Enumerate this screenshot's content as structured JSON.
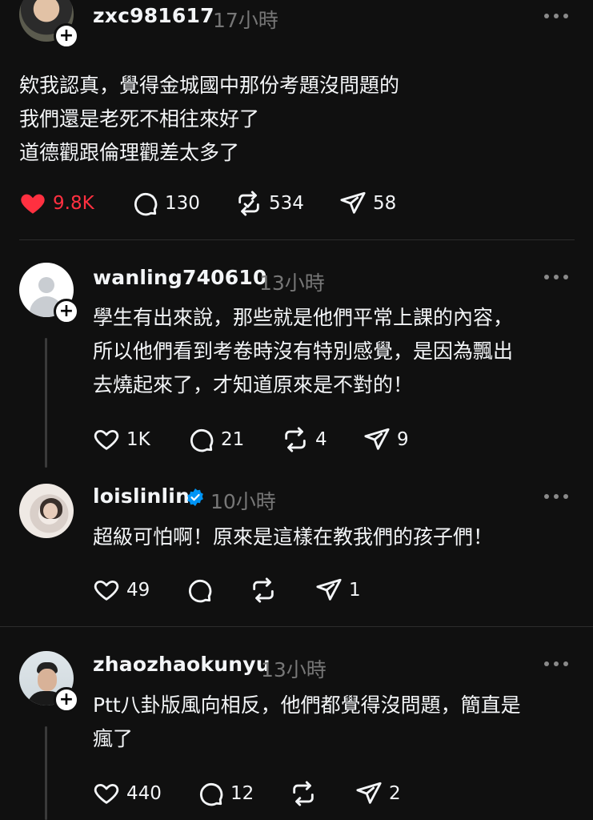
{
  "posts": [
    {
      "username": "zxc981617",
      "time": "17小時",
      "text": "欸我認真，覺得金城國中那份考題沒問題的\n我們還是老死不相往來好了\n道德觀跟倫理觀差太多了",
      "likes": "9.8K",
      "replies": "130",
      "reposts": "534",
      "shares": "58",
      "liked": true
    },
    {
      "username": "wanling740610",
      "time": "13小時",
      "text": "學生有出來說，那些就是他們平常上課的內容，\n所以他們看到考卷時沒有特別感覺，是因為飄出\n去燒起來了，才知道原來是不對的！",
      "likes": "1K",
      "replies": "21",
      "reposts": "4",
      "shares": "9"
    },
    {
      "username": "loislinlin",
      "time": "10小時",
      "text": "超級可怕啊！原來是這樣在教我們的孩子們！",
      "likes": "49",
      "shares": "1",
      "verified": true
    },
    {
      "username": "zhaozhaokunyu",
      "time": "13小時",
      "text": "Ptt八卦版風向相反，他們都覺得沒問題，簡直是\n瘋了",
      "likes": "440",
      "replies": "12",
      "shares": "2"
    }
  ],
  "colors": {
    "background": "#101010",
    "liked": "#ff3040",
    "verified": "#0095f6",
    "muted": "#777777"
  },
  "icons": [
    "heart-icon",
    "reply-icon",
    "repost-icon",
    "share-icon",
    "more-icon",
    "follow-plus-icon",
    "verified-badge-icon"
  ]
}
